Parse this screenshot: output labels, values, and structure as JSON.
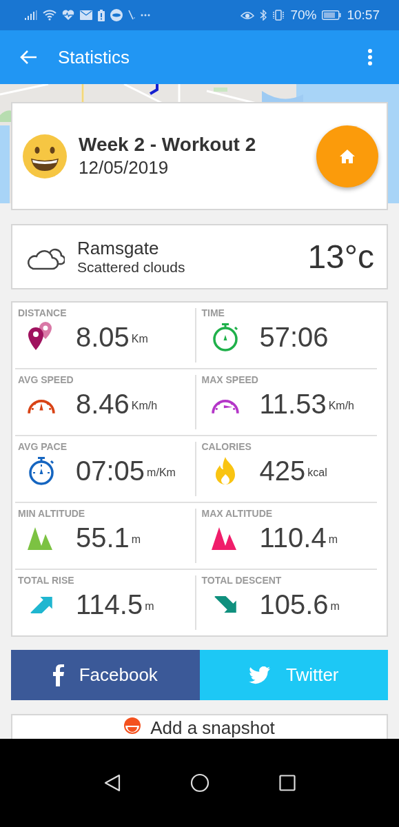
{
  "status_bar": {
    "battery": "70%",
    "time": "10:57"
  },
  "app_bar": {
    "title": "Statistics"
  },
  "workout": {
    "title": "Week 2 - Workout 2",
    "date": "12/05/2019"
  },
  "weather": {
    "place": "Ramsgate",
    "condition": "Scattered clouds",
    "temperature": "13°c"
  },
  "stats": [
    {
      "label": "DISTANCE",
      "kind": "distance",
      "value": "8.05",
      "unit": "Km"
    },
    {
      "label": "TIME",
      "kind": "time",
      "value": "57:06"
    },
    {
      "label": "AVG SPEED",
      "kind": "avg_speed",
      "value": "8.46",
      "unit": "Km/h"
    },
    {
      "label": "MAX SPEED",
      "kind": "max_speed",
      "value": "11.53",
      "unit": "Km/h"
    },
    {
      "label": "AVG PACE",
      "kind": "pace",
      "value": "07:05",
      "unit": "m/Km"
    },
    {
      "label": "CALORIES",
      "kind": "calories",
      "value": "425",
      "unit": "kcal"
    },
    {
      "label": "MIN ALTITUDE",
      "kind": "min_alt",
      "value": "55.1",
      "unit": "m"
    },
    {
      "label": "MAX ALTITUDE",
      "kind": "max_alt",
      "value": "110.4",
      "unit": "m"
    },
    {
      "label": "TOTAL RISE",
      "kind": "rise",
      "value": "114.5",
      "unit": "m"
    },
    {
      "label": "TOTAL DESCENT",
      "kind": "descent",
      "value": "105.6",
      "unit": "m"
    }
  ],
  "share": [
    {
      "kind": "facebook",
      "label": "Facebook"
    },
    {
      "kind": "twitter",
      "label": "Twitter"
    }
  ],
  "snapshot": {
    "label": "Add a snapshot"
  }
}
